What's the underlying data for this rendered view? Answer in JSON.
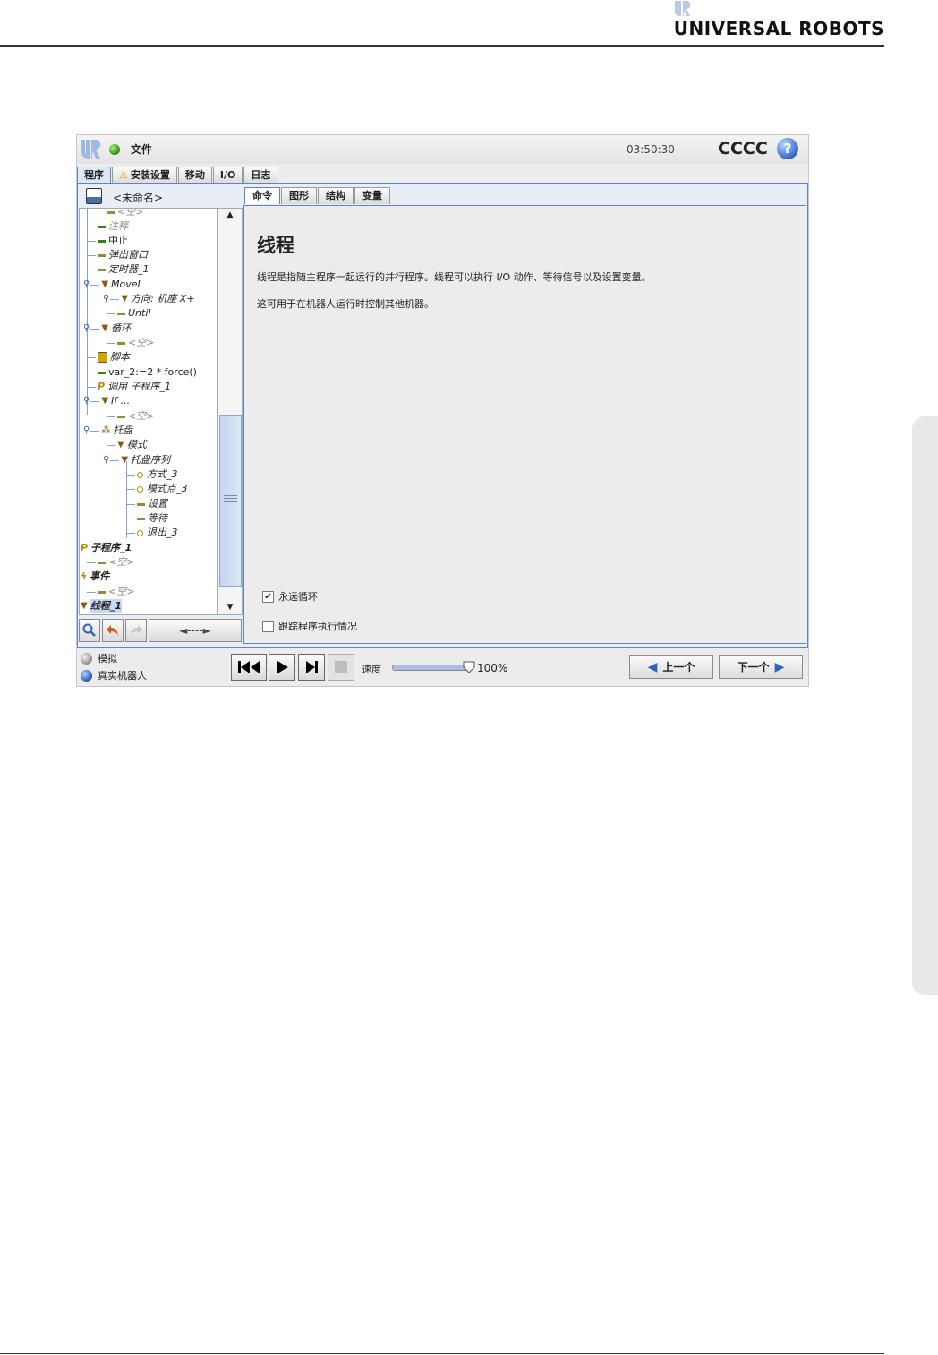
{
  "document": {
    "brand": "UNIVERSAL ROBOTS"
  },
  "app": {
    "file_menu": "文件",
    "clock": "03:50:30",
    "robot_name": "CCCC",
    "help_symbol": "?",
    "main_tabs": [
      {
        "label": "程序",
        "active": true
      },
      {
        "label": "安装设置",
        "warning": true
      },
      {
        "label": "移动"
      },
      {
        "label": "I/O"
      },
      {
        "label": "日志"
      }
    ],
    "program_name": "<未命名>",
    "tree": [
      {
        "label": "<空>"
      },
      {
        "label": "注释"
      },
      {
        "label": "中止"
      },
      {
        "label": "弹出窗口"
      },
      {
        "label": "定时器_1"
      },
      {
        "label": "MoveL"
      },
      {
        "label": "方向: 机座 X+"
      },
      {
        "label": "Until"
      },
      {
        "label": "循环"
      },
      {
        "label": "<空>"
      },
      {
        "label": "脚本"
      },
      {
        "label": "var_2:=2 * force()"
      },
      {
        "label": "调用 子程序_1"
      },
      {
        "label": "If ..."
      },
      {
        "label": "<空>"
      },
      {
        "label": "托盘"
      },
      {
        "label": "模式"
      },
      {
        "label": "托盘序列"
      },
      {
        "label": "方式_3"
      },
      {
        "label": "模式点_3"
      },
      {
        "label": "设置"
      },
      {
        "label": "等待"
      },
      {
        "label": "退出_3"
      },
      {
        "label": "子程序_1"
      },
      {
        "label": "<空>"
      },
      {
        "label": "事件"
      },
      {
        "label": "<空>"
      },
      {
        "label": "线程_1"
      }
    ],
    "toolbar": {
      "move_label": "◄----►"
    },
    "sub_tabs": [
      {
        "label": "命令",
        "active": true
      },
      {
        "label": "图形"
      },
      {
        "label": "结构"
      },
      {
        "label": "变量"
      }
    ],
    "command": {
      "title": "线程",
      "line1": "线程是指随主程序一起运行的并行程序。线程可以执行 I/O 动作、等待信号以及设置变量。",
      "line2": "这可用于在机器人运行时控制其他机器。",
      "loop_forever": "永远循环",
      "loop_forever_checked": true,
      "track_execution": "跟踪程序执行情况",
      "track_execution_checked": false
    },
    "bottom": {
      "mode_sim": "模拟",
      "mode_real": "真实机器人",
      "speed_label": "速度",
      "speed_value": "100%",
      "speed_fraction": 1.0,
      "prev_label": "上一个",
      "next_label": "下一个"
    }
  }
}
